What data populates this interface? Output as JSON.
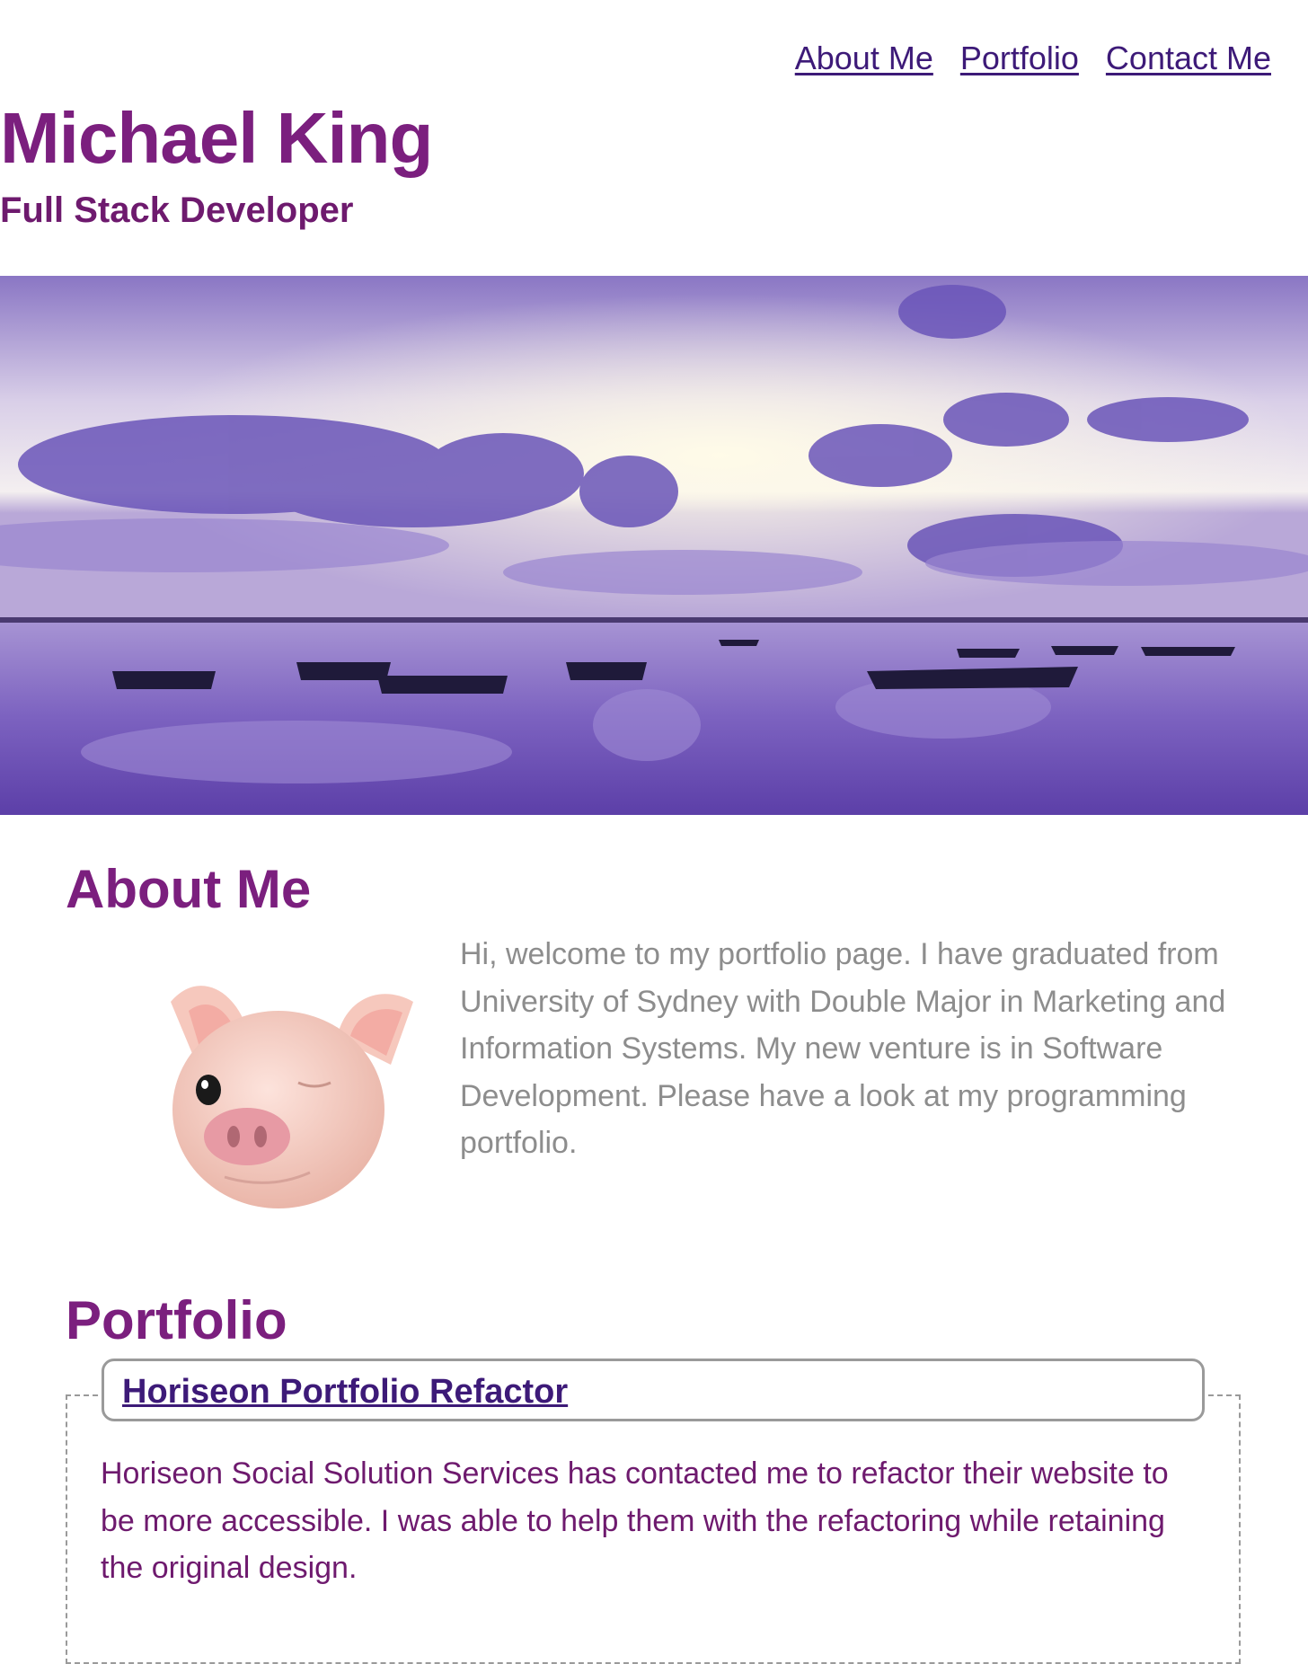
{
  "nav": {
    "items": [
      {
        "label": "About Me"
      },
      {
        "label": "Portfolio"
      },
      {
        "label": "Contact Me"
      }
    ]
  },
  "header": {
    "name": "Michael King",
    "role": "Full Stack Developer"
  },
  "hero": {
    "icon": "lake-sunset-boats-image"
  },
  "about": {
    "title": "About Me",
    "avatar_icon": "pig-face-icon",
    "text": "Hi, welcome to my portfolio page. I have graduated from University of Sydney with Double Major in Marketing and Information Systems. My new venture is in Software Development. Please have a look at my programming portfolio."
  },
  "portfolio": {
    "title": "Portfolio",
    "projects": [
      {
        "title": "Horiseon Portfolio Refactor",
        "description": "Horiseon Social Solution Services has contacted me to refactor their website to be more accessible. I was able to help them with the refactoring while retaining the original design."
      }
    ]
  },
  "colors": {
    "heading": "#7b1f7e",
    "link": "#3d1a78",
    "body_text": "#8d8d8d",
    "card_text": "#6e1a6e"
  }
}
